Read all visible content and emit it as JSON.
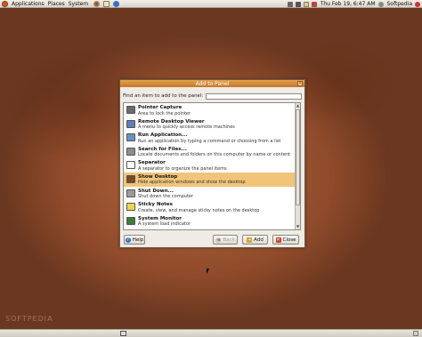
{
  "top_panel": {
    "menus": [
      "Applications",
      "Places",
      "System"
    ],
    "launchers": [
      "firefox-icon",
      "mail-icon",
      "help-icon"
    ],
    "tray_icons": [
      "network-icon",
      "volume-icon",
      "mail-notify-icon",
      "calendar-icon"
    ],
    "clock": "Thu Feb 19,  6:47 AM",
    "user": "Softpedia",
    "logo_color": "#d45a1c"
  },
  "dialog": {
    "title": "Add to Panel",
    "find_label": "Find an item to add to the panel:",
    "find_value": "",
    "items": [
      {
        "name": "Pointer Capture",
        "desc": "Area to lock the pointer",
        "icon": "pointer-capture-icon",
        "color": "#6b6b6b",
        "selected": false
      },
      {
        "name": "Remote Desktop Viewer",
        "desc": "A menu to quickly access remote machines",
        "icon": "remote-desktop-icon",
        "color": "#5b7fb6",
        "selected": false
      },
      {
        "name": "Run Application...",
        "desc": "Run an application by typing a command or choosing from a list",
        "icon": "run-application-icon",
        "color": "#6d8fbf",
        "selected": false
      },
      {
        "name": "Search for Files...",
        "desc": "Locate documents and folders on this computer by name or content",
        "icon": "search-files-icon",
        "color": "#8c8c8c",
        "selected": false
      },
      {
        "name": "Separator",
        "desc": "A separator to organize the panel items",
        "icon": "separator-icon",
        "color": "#ffffff",
        "selected": false
      },
      {
        "name": "Show Desktop",
        "desc": "Hide application windows and show the desktop",
        "icon": "show-desktop-icon",
        "color": "#7a4a2a",
        "selected": true
      },
      {
        "name": "Shut Down...",
        "desc": "Shut down the computer",
        "icon": "shutdown-icon",
        "color": "#9b9b9b",
        "selected": false
      },
      {
        "name": "Sticky Notes",
        "desc": "Create, view, and manage sticky notes on the desktop",
        "icon": "sticky-notes-icon",
        "color": "#e8d94a",
        "selected": false
      },
      {
        "name": "System Monitor",
        "desc": "A system load indicator",
        "icon": "system-monitor-icon",
        "color": "#3d7a3d",
        "selected": false
      }
    ],
    "buttons": {
      "help": "Help",
      "back": "Back",
      "add": "Add",
      "close": "Close"
    },
    "accent": "#c6752a",
    "selection_color": "#f0c57a"
  },
  "desktop": {
    "watermark": "SOFTPEDIA"
  }
}
